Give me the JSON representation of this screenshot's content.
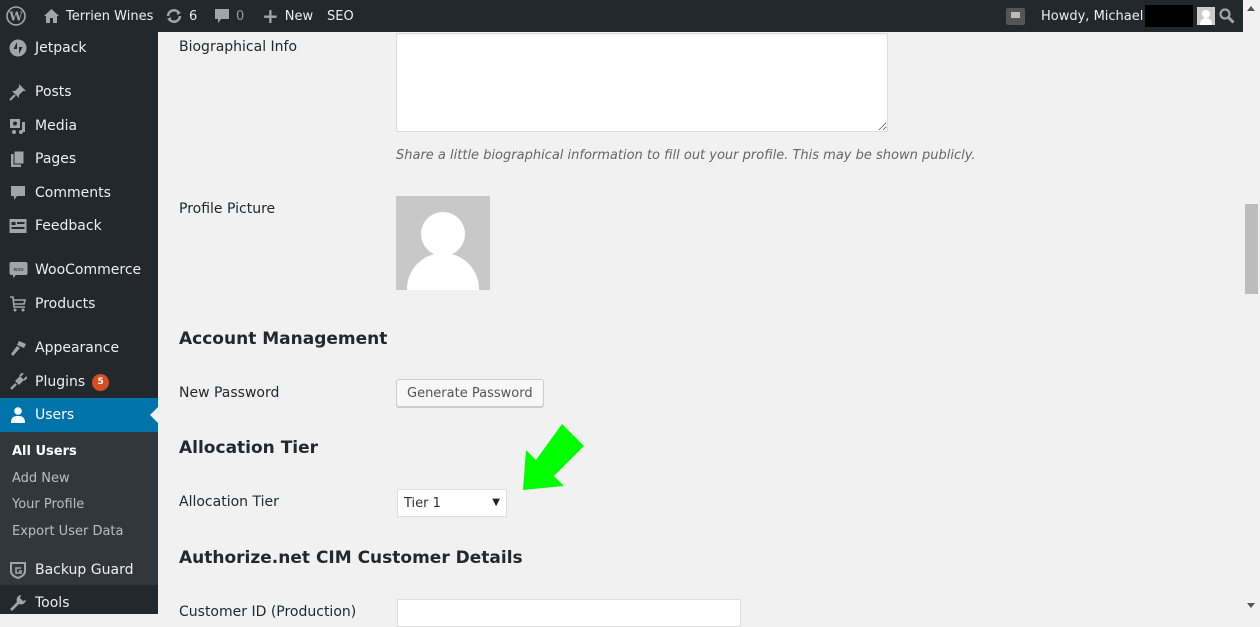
{
  "adminbar": {
    "site_name": "Terrien Wines",
    "updates_count": "6",
    "comments_count": "0",
    "new_label": "New",
    "seo_label": "SEO",
    "greeting": "Howdy, Michael"
  },
  "sidebar": {
    "items": [
      {
        "label": "Jetpack",
        "icon": "jetpack-icon"
      },
      {
        "label": "Posts",
        "icon": "pin-icon"
      },
      {
        "label": "Media",
        "icon": "media-icon"
      },
      {
        "label": "Pages",
        "icon": "pages-icon"
      },
      {
        "label": "Comments",
        "icon": "comment-icon"
      },
      {
        "label": "Feedback",
        "icon": "feedback-icon"
      },
      {
        "label": "WooCommerce",
        "icon": "woocommerce-icon"
      },
      {
        "label": "Products",
        "icon": "cart-icon"
      },
      {
        "label": "Appearance",
        "icon": "paintbrush-icon"
      },
      {
        "label": "Plugins",
        "icon": "plugin-icon",
        "badge": "5"
      },
      {
        "label": "Users",
        "icon": "user-icon",
        "current": true
      },
      {
        "label": "Backup Guard",
        "icon": "shield-icon"
      },
      {
        "label": "Tools",
        "icon": "wrench-icon"
      }
    ],
    "submenu": [
      {
        "label": "All Users",
        "current": true
      },
      {
        "label": "Add New"
      },
      {
        "label": "Your Profile"
      },
      {
        "label": "Export User Data"
      }
    ]
  },
  "main": {
    "bio_label": "Biographical Info",
    "bio_value": "",
    "bio_description": "Share a little biographical information to fill out your profile. This may be shown publicly.",
    "profile_picture_label": "Profile Picture",
    "account_management_title": "Account Management",
    "new_password_label": "New Password",
    "generate_password_button": "Generate Password",
    "allocation_tier_title": "Allocation Tier",
    "allocation_tier_label": "Allocation Tier",
    "allocation_tier_value": "Tier 1",
    "authorize_title": "Authorize.net CIM Customer Details",
    "customer_id_label": "Customer ID (Production)",
    "customer_id_value": ""
  },
  "colors": {
    "adminbar_bg": "#23282d",
    "current_menu": "#0073aa",
    "badge": "#d54e21",
    "annotation_arrow": "#00ff00"
  }
}
